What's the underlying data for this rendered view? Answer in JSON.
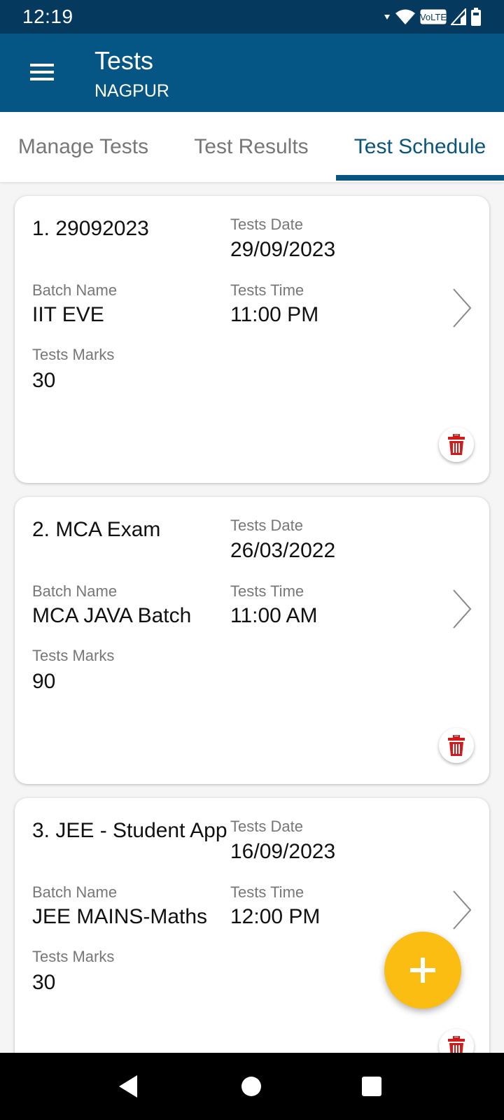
{
  "status_bar": {
    "time": "12:19",
    "icons": [
      "data-arrow-icon",
      "wifi-icon",
      "volte-icon",
      "signal-icon",
      "battery-icon"
    ],
    "volte_label": "VoLTE"
  },
  "app_bar": {
    "title": "Tests",
    "subtitle": "NAGPUR",
    "menu_icon": "hamburger-menu-icon"
  },
  "tabs": [
    {
      "label": "Manage Tests",
      "active": false
    },
    {
      "label": "Test Results",
      "active": false
    },
    {
      "label": "Test Schedule",
      "active": true
    }
  ],
  "labels": {
    "date": "Tests Date",
    "batch": "Batch Name",
    "time": "Tests Time",
    "marks": "Tests Marks"
  },
  "tests": [
    {
      "title": "1. 29092023",
      "date": "29/09/2023",
      "batch": "IIT EVE",
      "time": "11:00 PM",
      "marks": "30"
    },
    {
      "title": "2. MCA Exam",
      "date": "26/03/2022",
      "batch": "MCA JAVA Batch",
      "time": "11:00 AM",
      "marks": "90"
    },
    {
      "title": "3. JEE - Student App",
      "date": "16/09/2023",
      "batch": "JEE MAINS-Maths",
      "time": "12:00 PM",
      "marks": "30"
    }
  ],
  "colors": {
    "status_bar": "#053a5e",
    "app_bar": "#055585",
    "tab_active": "#08557f",
    "fab": "#fbbd12",
    "delete": "#d11a1a"
  },
  "fab": {
    "icon": "plus-icon"
  },
  "nav_bar": {
    "buttons": [
      "back-icon",
      "home-icon",
      "recents-icon"
    ]
  }
}
